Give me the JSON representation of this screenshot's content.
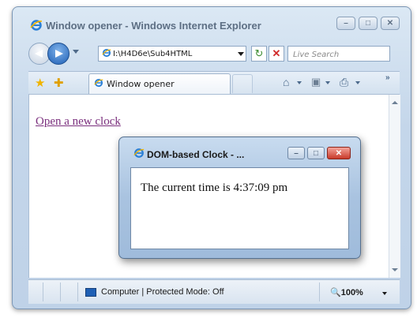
{
  "window": {
    "title": "Window opener - Windows Internet Explorer"
  },
  "nav": {
    "address": "I:\\H4D6e\\Sub4HTML",
    "search_placeholder": "Live Search"
  },
  "tabs": [
    {
      "label": "Window opener"
    }
  ],
  "content": {
    "link_text": "Open a new clock"
  },
  "status": {
    "zone_text": "Computer | Protected Mode: Off",
    "zoom": "100%"
  },
  "popup": {
    "title": "DOM-based Clock - ...",
    "message": "The current time is 4:37:09 pm"
  },
  "colors": {
    "visited_link": "#7a2f7d",
    "close_button": "#c8392a",
    "accent_blue": "#1e5fb5"
  },
  "icons": {
    "ie_logo": "ie-logo-icon",
    "back": "back-arrow-icon",
    "forward": "forward-arrow-icon",
    "refresh": "refresh-icon",
    "stop": "stop-icon",
    "favorites": "favorites-star-icon",
    "add_favorites": "add-favorites-icon",
    "home": "home-icon",
    "feeds": "feeds-icon",
    "print": "print-icon",
    "computer": "computer-icon",
    "zoom": "zoom-icon"
  }
}
